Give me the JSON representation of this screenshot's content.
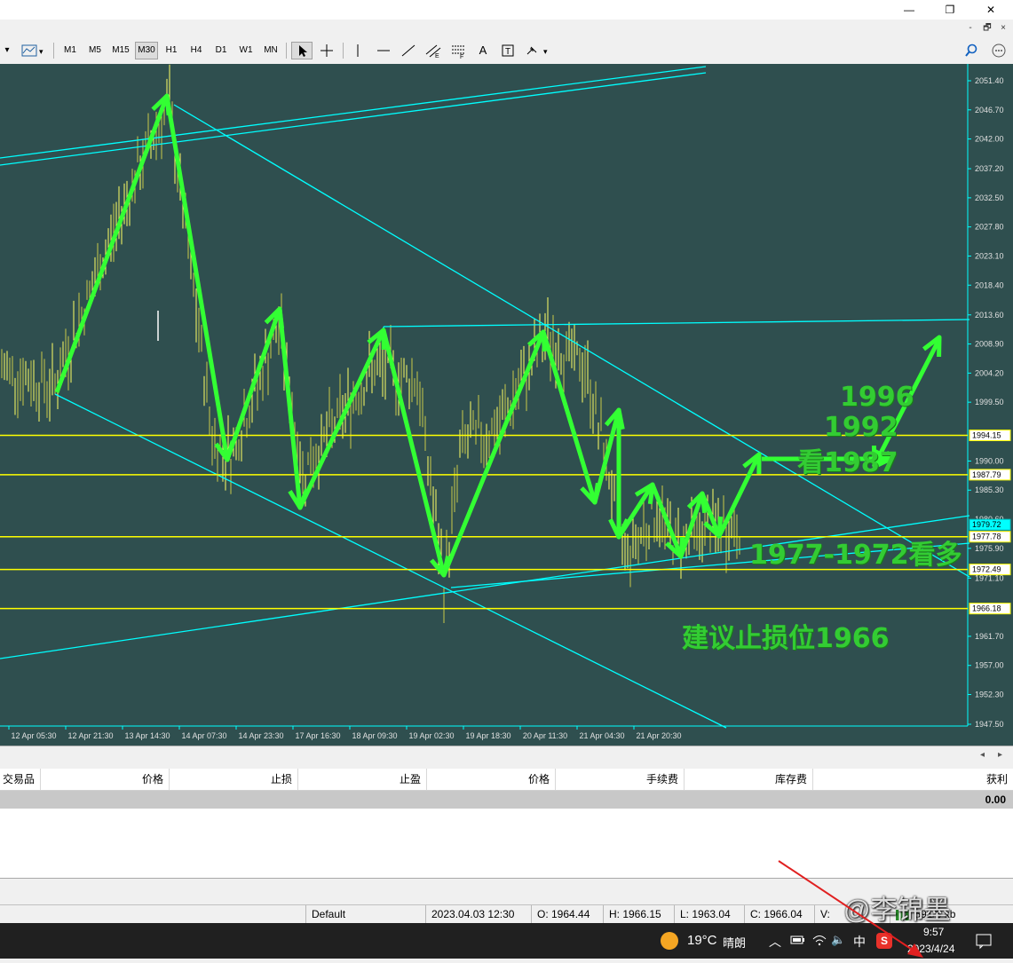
{
  "window": {
    "controls": {
      "minimize": "—",
      "restore": "❐",
      "close": "✕"
    },
    "mdi_controls": {
      "minimize": "-",
      "restore": "🗗",
      "close": "×"
    }
  },
  "toolbar": {
    "timeframes": [
      "M1",
      "M5",
      "M15",
      "M30",
      "H1",
      "H4",
      "D1",
      "W1",
      "MN"
    ],
    "active_timeframe": "M30",
    "tool_icons": [
      "cursor-icon",
      "crosshair-icon",
      "vertical-line-icon",
      "horizontal-line-icon",
      "trendline-icon",
      "equidistant-channel-icon",
      "fibonacci-icon",
      "text-icon",
      "text-label-icon",
      "arrows-icon"
    ],
    "text_tool": "A"
  },
  "chart_data": {
    "type": "candlestick",
    "symbol_period": "M30",
    "y_ticks": [
      "2051.40",
      "2046.70",
      "2042.00",
      "2037.20",
      "2032.50",
      "2027.80",
      "2023.10",
      "2018.40",
      "2013.60",
      "2008.90",
      "2004.20",
      "1999.50",
      "1990.00",
      "1985.30",
      "1975.90",
      "1971.10",
      "1961.70",
      "1957.00",
      "1952.30",
      "1947.50"
    ],
    "ylim": [
      1947.5,
      2051.4
    ],
    "x_ticks": [
      "12 Apr 05:30",
      "12 Apr 21:30",
      "13 Apr 14:30",
      "14 Apr 07:30",
      "14 Apr 23:30",
      "17 Apr 16:30",
      "18 Apr 09:30",
      "19 Apr 02:30",
      "19 Apr 18:30",
      "20 Apr 11:30",
      "21 Apr 04:30",
      "21 Apr 20:30"
    ],
    "price_boxes": [
      {
        "value": "1994.15",
        "style": "yellow-line"
      },
      {
        "value": "1987.79",
        "style": "yellow-line"
      },
      {
        "value": "1979.72",
        "style": "current-price"
      },
      {
        "value": "1977.78",
        "style": "yellow-line"
      },
      {
        "value": "1972.49",
        "style": "yellow-line"
      },
      {
        "value": "1966.18",
        "style": "yellow-line"
      }
    ],
    "partial_tick": "1980.60",
    "horizontal_levels": [
      1994.15,
      1987.79,
      1977.78,
      1972.49,
      1966.18
    ],
    "annotations": [
      "1996",
      "1992",
      "看1987",
      "1977-1972看多",
      "建议止损位1966"
    ],
    "colors": {
      "background": "#2f4f4f",
      "levels": "#ffff00",
      "channels": "#00ffff",
      "arrows": "#33ff33",
      "candles": "#ffff66"
    },
    "grid": false
  },
  "terminal": {
    "columns": [
      "交易品种",
      "价格",
      "止损",
      "止盈",
      "价格",
      "手续费",
      "库存费",
      "获利"
    ],
    "summary_profit": "0.00"
  },
  "statusbar": {
    "profile": "Default",
    "datetime": "2023.04.03 12:30",
    "open": "O: 1964.44",
    "high": "H: 1966.15",
    "low": "L: 1963.04",
    "close": "C: 1966.04",
    "volume": "V:",
    "traffic": "591/3 kb"
  },
  "taskbar": {
    "weather_temp": "19°C",
    "weather_desc": "晴朗",
    "input_method": "中",
    "time": "9:57",
    "date": "2023/4/24",
    "watermark": "@李锦墨"
  }
}
